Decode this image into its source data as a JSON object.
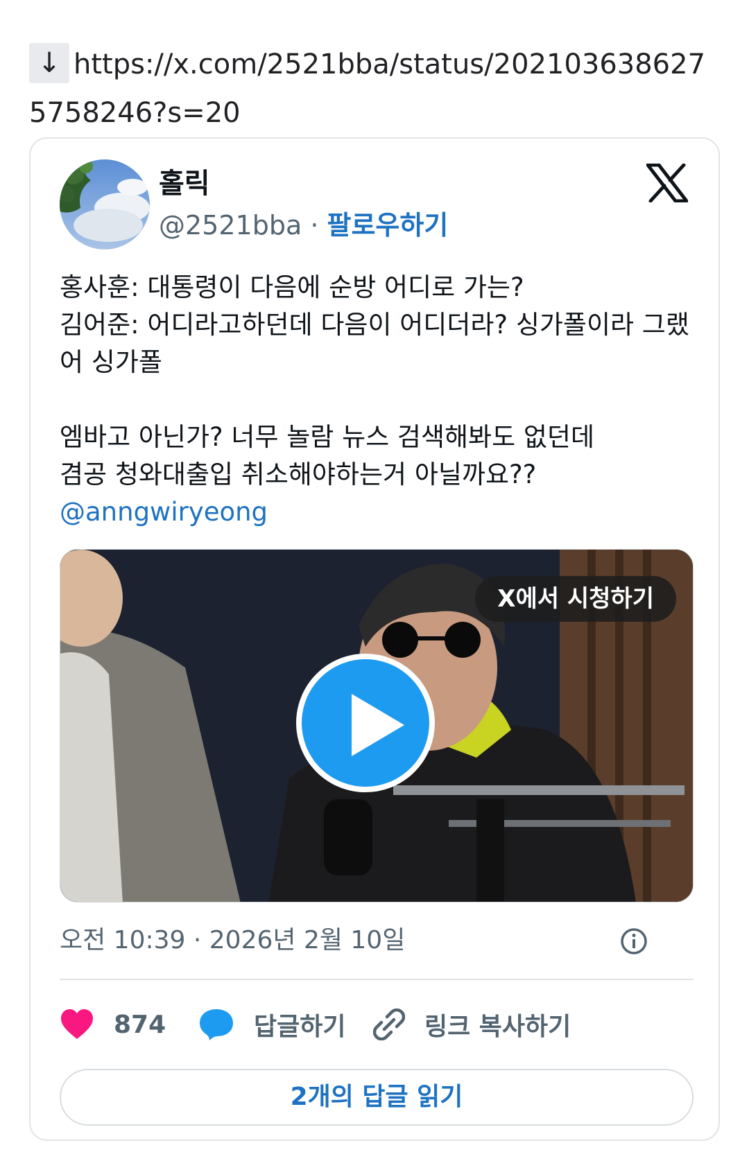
{
  "link": {
    "arrow": "↓",
    "url": "https://x.com/2521bba/status/2021036386275758246?s=20"
  },
  "tweet": {
    "display_name": "홀릭",
    "handle": "@2521bba",
    "separator": " · ",
    "follow_label": "팔로우하기",
    "text_lines": [
      "홍사훈: 대통령이 다음에 순방 어디로 가는?\n김어준: 어디라고하던데 다음이 어디더라? 싱가폴이라 그랬어 싱가폴",
      "엠바고 아닌가? 너무 놀람 뉴스 검색해봐도 없던데\n겸공 청와대출입 취소해야하는거 아닐까요??"
    ],
    "mention": "@anngwiryeong",
    "media": {
      "watch_label": "X에서 시청하기",
      "play_icon": "play-icon"
    },
    "timestamp": "오전 10:39 · 2026년 2월 10일",
    "like_count": "874",
    "reply_label": "답글하기",
    "copy_link_label": "링크 복사하기",
    "read_replies_label": "2개의 답글 읽기"
  },
  "colors": {
    "accent": "#1d72c2",
    "like": "#f91880",
    "reply": "#1d9bf0",
    "muted": "#536471"
  }
}
